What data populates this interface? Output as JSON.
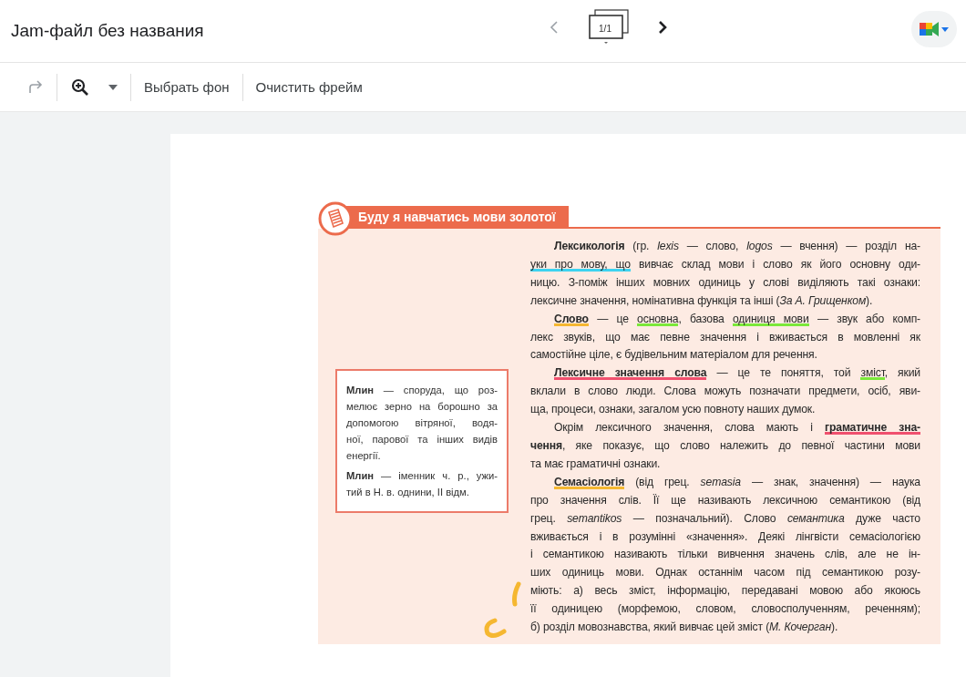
{
  "header": {
    "title": "Jam-файл без названия",
    "prev": {
      "disabled": true
    },
    "next": {
      "disabled": false
    },
    "frame_counter": "1/1"
  },
  "toolbar": {
    "redo": {
      "disabled": true
    },
    "buttons": [
      "Выбрать фон",
      "Очистить фрейм"
    ]
  },
  "frame": {
    "banner": "Буду я навчатись мови золотої",
    "sidebox": [
      {
        "lines": [
          [
            {
              "text": "**Млин** — споруда, що роз-"
            }
          ],
          [
            {
              "text": "мелює зерно на борошно за"
            }
          ],
          [
            {
              "text": "допомогою вітряної, водя-"
            }
          ],
          [
            {
              "text": "ної, парової та інших видів"
            }
          ],
          [
            {
              "text": "енергії."
            }
          ]
        ]
      },
      {
        "lines": [
          [
            {
              "text": "**Млин** — іменник ч. р., ужи-"
            }
          ],
          [
            {
              "text": "тий в Н. в. однини, II відм."
            }
          ]
        ]
      }
    ],
    "paragraphs": [
      {
        "lines": [
          [
            {
              "text": "**Лексикологія** (гр. *lexis* — слово, *logos* — вчення) — розділ на-"
            }
          ],
          [
            {
              "text": "уки про мову, що",
              "color": "#3dd3f0"
            },
            {
              "text": " вивчає склад мови і слово як його основну оди-"
            }
          ],
          [
            {
              "text": "ницю. З-поміж інших мовних одиниць у слові виділяють такі ознаки:"
            }
          ],
          [
            {
              "text": "лексичне значення, номінативна функція та інші (*За А. Грищенком*)."
            }
          ]
        ]
      },
      {
        "lines": [
          [
            {
              "text": "**Слово**",
              "color": "#f5b731"
            },
            {
              "text": " — це "
            },
            {
              "text": "основна",
              "color": "#7be83a"
            },
            {
              "text": ", базова "
            },
            {
              "text": "одиниця мови",
              "color": "#7be83a"
            },
            {
              "text": " — звук або комп-"
            }
          ],
          [
            {
              "text": "лекс звуків, що має певне значення і вживається в мовленні як"
            }
          ],
          [
            {
              "text": "самостійне ціле, є будівельним матеріалом для речення."
            }
          ]
        ]
      },
      {
        "lines": [
          [
            {
              "text": "**Лексичне значення слова**",
              "color": "#f0506e"
            },
            {
              "text": " — це те поняття, той "
            },
            {
              "text": "зміст",
              "color": "#7be83a"
            },
            {
              "text": ", який"
            }
          ],
          [
            {
              "text": "вклали в слово люди. Слова можуть позначати предмети, осіб, яви-"
            }
          ],
          [
            {
              "text": "ща, процеси, ознаки, загалом усю повноту наших думок."
            }
          ]
        ]
      },
      {
        "lines": [
          [
            {
              "text": "Окрім лексичного значення, слова мають і "
            },
            {
              "text": "**граматичне зна-**",
              "color": "#f0506e"
            }
          ],
          [
            {
              "text": "**чення**, яке показує, що слово належить до певної частини мови"
            }
          ],
          [
            {
              "text": "та має граматичні ознаки."
            }
          ]
        ]
      },
      {
        "lines": [
          [
            {
              "text": "**Семасіологія**",
              "color": "#f5b731"
            },
            {
              "text": " (від грец. *semasia* — знак, значення) — наука"
            }
          ],
          [
            {
              "text": "про значення слів. Її ще називають лексичною семантикою (від"
            }
          ],
          [
            {
              "text": "грец. *semantikos* — позначальний). Слово *семантика* дуже часто"
            }
          ],
          [
            {
              "text": "вживається і в розумінні «значення». Деякі лінгвісти семасіологією"
            }
          ],
          [
            {
              "text": "і семантикою називають тільки вивчення значень слів, але не ін-"
            }
          ],
          [
            {
              "text": "ших одиниць мови. Однак останнім часом під семантикою розу-"
            }
          ],
          [
            {
              "text": "міють: а) весь зміст, інформацію, передавані мовою або якоюсь"
            }
          ],
          [
            {
              "text": "її одиницею (морфемою, словом, словосполученням, реченням);"
            }
          ],
          [
            {
              "text": "б) розділ мовознавства, який вивчає цей зміст (*М. Кочерган*)."
            }
          ]
        ]
      }
    ]
  }
}
